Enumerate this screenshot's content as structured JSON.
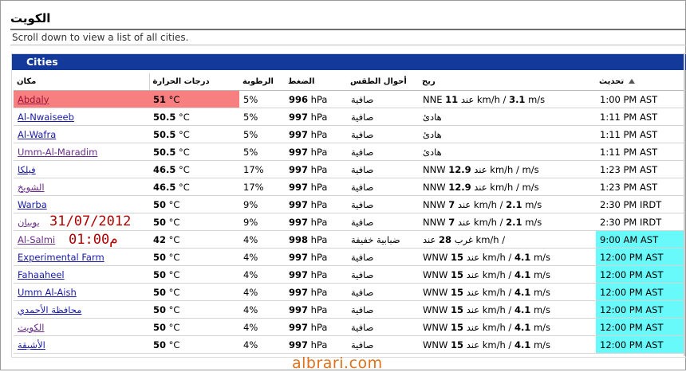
{
  "page": {
    "title": "الكويت",
    "subtitle": "Scroll down to view a list of all cities."
  },
  "panel": {
    "title": "Cities"
  },
  "table": {
    "columns": [
      "مكان",
      "درجات الحرارة",
      "الرطوبة",
      "الضغط",
      "أحوال الطقس",
      "ريح",
      "تحديث"
    ],
    "rows": [
      {
        "city": "Abdaly",
        "temp": "51",
        "temp_unit": "°C",
        "humidity": "5%",
        "pressure": "996",
        "pressure_unit": "hPa",
        "condition": "صافية",
        "wind_dir": "NNE",
        "wind_kmh": "11",
        "wind_mid": "عند km/h /",
        "wind_ms": "3.1",
        "wind_ms_unit": "m/s",
        "updated": "1:00 PM AST",
        "highlight": true,
        "visited": false,
        "upd_hl": false
      },
      {
        "city": "Al-Nwaiseeb",
        "temp": "50.5",
        "temp_unit": "°C",
        "humidity": "5%",
        "pressure": "997",
        "pressure_unit": "hPa",
        "condition": "صافية",
        "wind_dir": "",
        "wind_kmh": "",
        "wind_mid": "هادئ",
        "wind_ms": "",
        "wind_ms_unit": "",
        "updated": "1:11 PM AST",
        "highlight": false,
        "visited": false,
        "upd_hl": false
      },
      {
        "city": "Al-Wafra",
        "temp": "50.5",
        "temp_unit": "°C",
        "humidity": "5%",
        "pressure": "997",
        "pressure_unit": "hPa",
        "condition": "صافية",
        "wind_dir": "",
        "wind_kmh": "",
        "wind_mid": "هادئ",
        "wind_ms": "",
        "wind_ms_unit": "",
        "updated": "1:11 PM AST",
        "highlight": false,
        "visited": false,
        "upd_hl": false
      },
      {
        "city": "Umm-Al-Maradim",
        "temp": "50.5",
        "temp_unit": "°C",
        "humidity": "5%",
        "pressure": "997",
        "pressure_unit": "hPa",
        "condition": "صافية",
        "wind_dir": "",
        "wind_kmh": "",
        "wind_mid": "هادئ",
        "wind_ms": "",
        "wind_ms_unit": "",
        "updated": "1:11 PM AST",
        "highlight": false,
        "visited": true,
        "upd_hl": false
      },
      {
        "city": "فيلكا",
        "temp": "46.5",
        "temp_unit": "°C",
        "humidity": "17%",
        "pressure": "997",
        "pressure_unit": "hPa",
        "condition": "صافية",
        "wind_dir": "NNW",
        "wind_kmh": "12.9",
        "wind_mid": "عند km/h /",
        "wind_ms": "",
        "wind_ms_unit": "m/s",
        "updated": "1:23 PM AST",
        "highlight": false,
        "visited": false,
        "upd_hl": false
      },
      {
        "city": "الشويخ",
        "temp": "46.5",
        "temp_unit": "°C",
        "humidity": "17%",
        "pressure": "997",
        "pressure_unit": "hPa",
        "condition": "صافية",
        "wind_dir": "NNW",
        "wind_kmh": "12.9",
        "wind_mid": "عند km/h /",
        "wind_ms": "",
        "wind_ms_unit": "m/s",
        "updated": "1:23 PM AST",
        "highlight": false,
        "visited": true,
        "upd_hl": false
      },
      {
        "city": "Warba",
        "temp": "50",
        "temp_unit": "°C",
        "humidity": "9%",
        "pressure": "997",
        "pressure_unit": "hPa",
        "condition": "صافية",
        "wind_dir": "NNW",
        "wind_kmh": "7",
        "wind_mid": "عند km/h /",
        "wind_ms": "2.1",
        "wind_ms_unit": "m/s",
        "updated": "2:30 PM IRDT",
        "highlight": false,
        "visited": false,
        "upd_hl": false
      },
      {
        "city": "بوبيان",
        "temp": "50",
        "temp_unit": "°C",
        "humidity": "9%",
        "pressure": "997",
        "pressure_unit": "hPa",
        "condition": "صافية",
        "wind_dir": "NNW",
        "wind_kmh": "7",
        "wind_mid": "عند km/h /",
        "wind_ms": "2.1",
        "wind_ms_unit": "m/s",
        "updated": "2:30 PM IRDT",
        "highlight": false,
        "visited": true,
        "upd_hl": false
      },
      {
        "city": "Al-Salmi",
        "temp": "42",
        "temp_unit": "°C",
        "humidity": "4%",
        "pressure": "998",
        "pressure_unit": "hPa",
        "condition": "ضبابية خفيفة",
        "wind_dir": "غرب",
        "wind_kmh": "28",
        "wind_mid": "عند km/h /",
        "wind_ms": "",
        "wind_ms_unit": "",
        "updated": "9:00 AM AST",
        "highlight": false,
        "visited": true,
        "upd_hl": true
      },
      {
        "city": "Experimental Farm",
        "temp": "50",
        "temp_unit": "°C",
        "humidity": "4%",
        "pressure": "997",
        "pressure_unit": "hPa",
        "condition": "صافية",
        "wind_dir": "WNW",
        "wind_kmh": "15",
        "wind_mid": "عند km/h /",
        "wind_ms": "4.1",
        "wind_ms_unit": "m/s",
        "updated": "12:00 PM AST",
        "highlight": false,
        "visited": false,
        "upd_hl": true
      },
      {
        "city": "Fahaaheel",
        "temp": "50",
        "temp_unit": "°C",
        "humidity": "4%",
        "pressure": "997",
        "pressure_unit": "hPa",
        "condition": "صافية",
        "wind_dir": "WNW",
        "wind_kmh": "15",
        "wind_mid": "عند km/h /",
        "wind_ms": "4.1",
        "wind_ms_unit": "m/s",
        "updated": "12:00 PM AST",
        "highlight": false,
        "visited": false,
        "upd_hl": true
      },
      {
        "city": "Umm Al-Aish",
        "temp": "50",
        "temp_unit": "°C",
        "humidity": "4%",
        "pressure": "997",
        "pressure_unit": "hPa",
        "condition": "صافية",
        "wind_dir": "WNW",
        "wind_kmh": "15",
        "wind_mid": "عند km/h /",
        "wind_ms": "4.1",
        "wind_ms_unit": "m/s",
        "updated": "12:00 PM AST",
        "highlight": false,
        "visited": false,
        "upd_hl": true
      },
      {
        "city": "محافظة الأحمدي",
        "temp": "50",
        "temp_unit": "°C",
        "humidity": "4%",
        "pressure": "997",
        "pressure_unit": "hPa",
        "condition": "صافية",
        "wind_dir": "WNW",
        "wind_kmh": "15",
        "wind_mid": "عند km/h /",
        "wind_ms": "4.1",
        "wind_ms_unit": "m/s",
        "updated": "12:00 PM AST",
        "highlight": false,
        "visited": false,
        "upd_hl": true
      },
      {
        "city": "الكويت",
        "temp": "50",
        "temp_unit": "°C",
        "humidity": "4%",
        "pressure": "997",
        "pressure_unit": "hPa",
        "condition": "صافية",
        "wind_dir": "WNW",
        "wind_kmh": "15",
        "wind_mid": "عند km/h /",
        "wind_ms": "4.1",
        "wind_ms_unit": "m/s",
        "updated": "12:00 PM AST",
        "highlight": false,
        "visited": true,
        "upd_hl": true
      },
      {
        "city": "الأشيقة",
        "temp": "50",
        "temp_unit": "°C",
        "humidity": "4%",
        "pressure": "997",
        "pressure_unit": "hPa",
        "condition": "صافية",
        "wind_dir": "WNW",
        "wind_kmh": "15",
        "wind_mid": "عند km/h /",
        "wind_ms": "4.1",
        "wind_ms_unit": "m/s",
        "updated": "12:00 PM AST",
        "highlight": false,
        "visited": false,
        "upd_hl": true
      }
    ]
  },
  "overlay": {
    "date": "31/07/2012",
    "time": "01:00م"
  },
  "watermark": "albrari.com",
  "colors": {
    "header_bar": "#13399a",
    "row_highlight": "#f77f7f",
    "update_highlight": "#68fafa",
    "overlay_text": "#b00000",
    "watermark": "#e0701a"
  }
}
